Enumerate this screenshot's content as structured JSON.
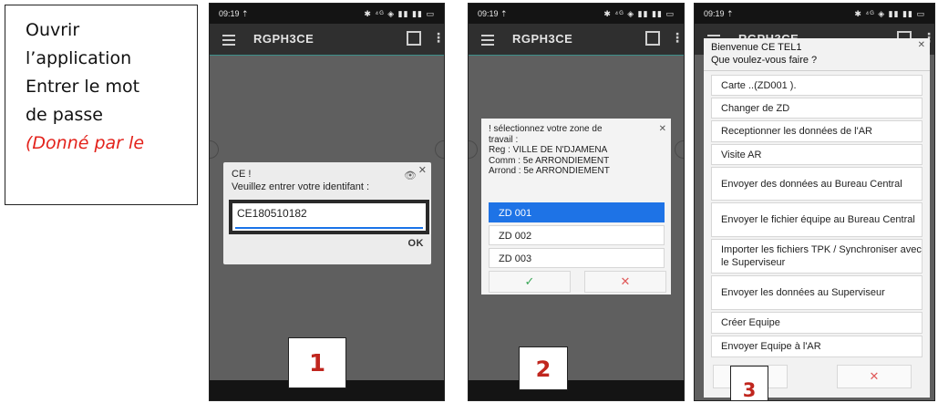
{
  "instructions": {
    "lines": [
      "Ouvrir",
      "l’application",
      "Entrer le mot",
      "de passe"
    ],
    "note": "(Donné par le"
  },
  "status_bar": {
    "time": "09:19 ⇡",
    "icons": "✱ ⁴ᴳ ◈ ▮▮ ▮▮ ▭"
  },
  "app": {
    "title": "RGPH3CE"
  },
  "phone1": {
    "dialog_title": "CE !",
    "dialog_prompt": "Veuillez entrer votre identifant :",
    "identifier_value": "CE180510182",
    "ok_label": "OK",
    "step": "1"
  },
  "phone2": {
    "info_lines": [
      "! sélectionnez votre zone de",
      "travail :",
      "Reg : VILLE DE N'DJAMENA",
      "Comm : 5e ARRONDIEMENT",
      "Arrond : 5e ARRONDIEMENT"
    ],
    "zones": [
      "ZD 001",
      "ZD 002",
      "ZD 003"
    ],
    "selected_zone": "ZD 001",
    "confirm_symbol": "✓",
    "cancel_symbol": "✕",
    "step": "2"
  },
  "phone3": {
    "title": "Bienvenue CE TEL1",
    "subtitle": "Que voulez-vous faire ?",
    "menu": [
      "Carte ..(ZD001 ).",
      "Changer de ZD",
      "Receptionner les données de l'AR",
      "Visite AR",
      "Envoyer des données au Bureau Central",
      "Envoyer le fichier équipe au Bureau Central",
      "Importer les fichiers TPK / Synchroniser avec le Superviseur",
      "Envoyer les données au Superviseur",
      "Créer Equipe",
      "Envoyer Equipe à l'AR"
    ],
    "cancel_symbol": "✕",
    "step": "3"
  },
  "colors": {
    "accent_blue": "#1e73e6",
    "step_red": "#c0261e",
    "note_red": "#e3221b",
    "confirm_green": "#3aa657",
    "cancel_red": "#e05a5a"
  }
}
